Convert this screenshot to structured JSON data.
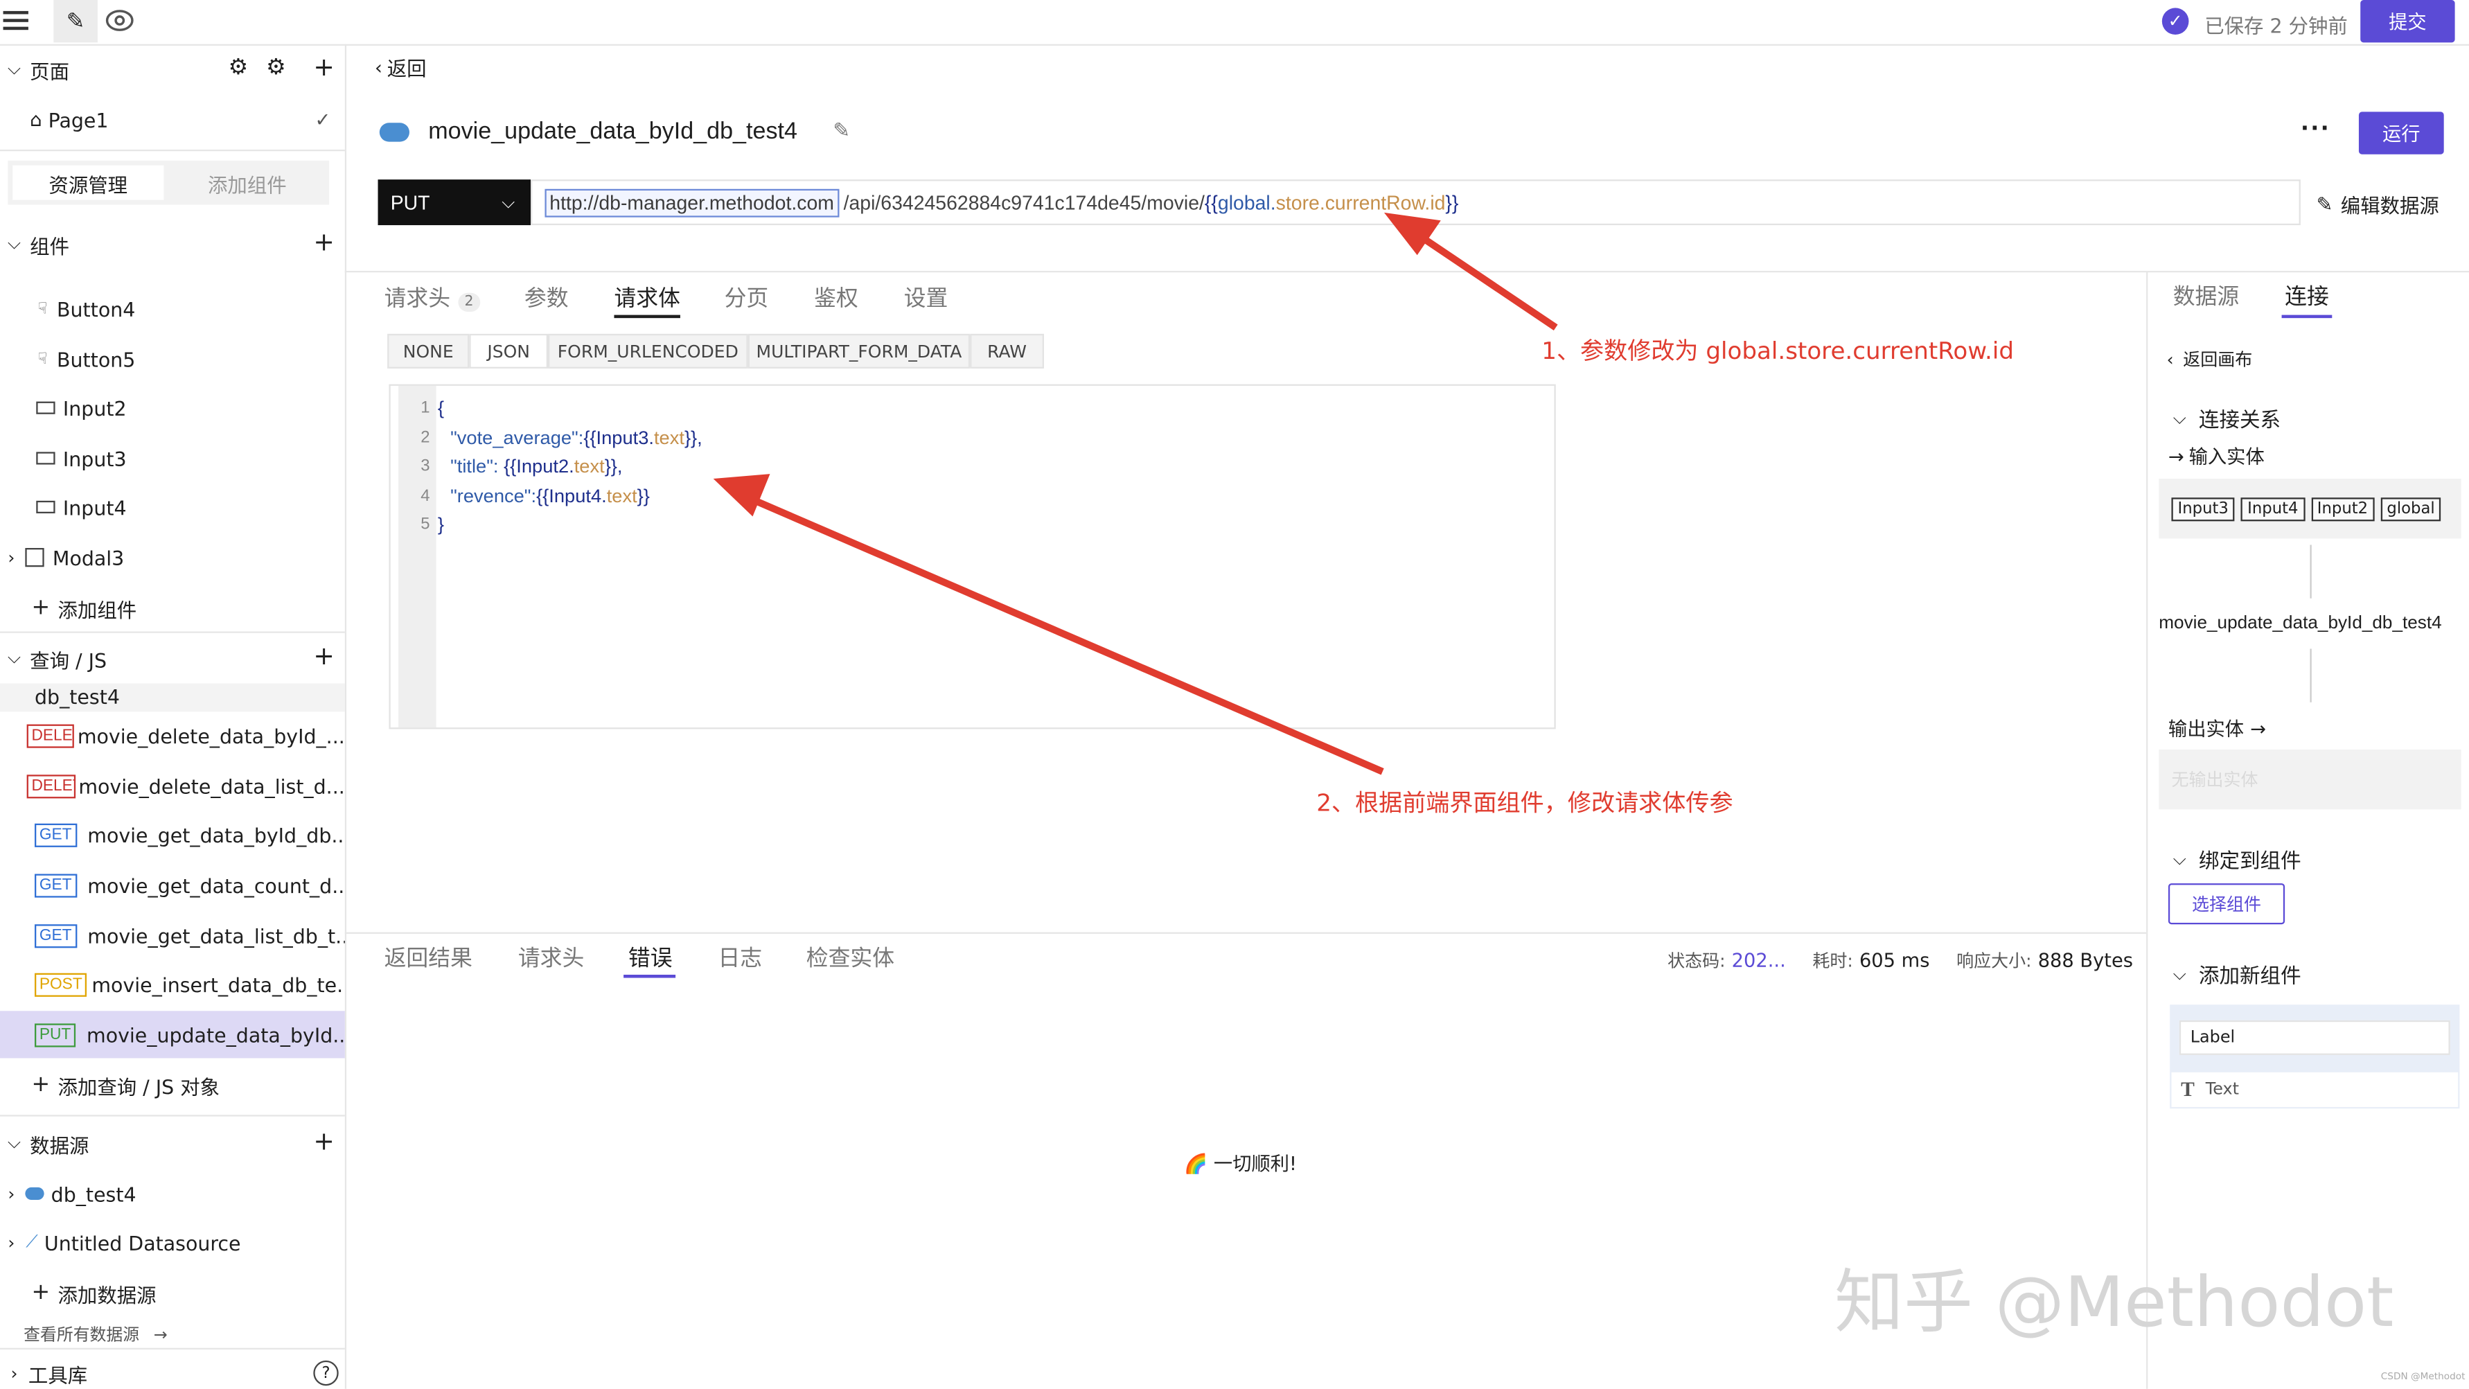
{
  "topbar": {
    "saved_text": "已保存 2 分钟前",
    "submit_label": "提交"
  },
  "sidebar": {
    "pages_title": "页面",
    "page1": "Page1",
    "tab_resources": "资源管理",
    "tab_add_component": "添加组件",
    "components_title": "组件",
    "components": [
      "Button4",
      "Button5",
      "Input2",
      "Input3",
      "Input4",
      "Modal3"
    ],
    "add_component": "添加组件",
    "queries_title": "查询 / JS",
    "queries_group": "db_test4",
    "queries": [
      {
        "method": "DELETE",
        "name": "movie_delete_data_byId_..."
      },
      {
        "method": "DELETE",
        "name": "movie_delete_data_list_d..."
      },
      {
        "method": "GET",
        "name": "movie_get_data_byId_db..."
      },
      {
        "method": "GET",
        "name": "movie_get_data_count_d..."
      },
      {
        "method": "GET",
        "name": "movie_get_data_list_db_t..."
      },
      {
        "method": "POST",
        "name": "movie_insert_data_db_te..."
      },
      {
        "method": "PUT",
        "name": "movie_update_data_byId..."
      }
    ],
    "add_query": "添加查询 / JS 对象",
    "datasources_title": "数据源",
    "datasources": [
      "db_test4",
      "Untitled Datasource"
    ],
    "add_datasource": "添加数据源",
    "view_all_datasources": "查看所有数据源",
    "library": "工具库"
  },
  "main": {
    "back_label": "返回",
    "query_name": "movie_update_data_byId_db_test4",
    "run_label": "运行",
    "method": "PUT",
    "url_base": "http://db-manager.methodot.com",
    "url_path": "/api/63424562884c9741c174de45/movie/",
    "url_binding_open": "{{",
    "url_binding_global": "global.",
    "url_binding_store": "store.currentRow.id",
    "url_binding_close": "}}",
    "edit_datasource": "编辑数据源",
    "tabs": [
      "请求头",
      "参数",
      "请求体",
      "分页",
      "鉴权",
      "设置"
    ],
    "header_count": "2",
    "body_tabs": [
      "NONE",
      "JSON",
      "FORM_URLENCODED",
      "MULTIPART_FORM_DATA",
      "RAW"
    ],
    "code_lines": [
      {
        "no": "1",
        "parts": [
          {
            "c": "p",
            "t": "{"
          }
        ]
      },
      {
        "no": "2",
        "parts": [
          {
            "c": "k",
            "t": "\"vote_average\":"
          },
          {
            "c": "p",
            "t": "{{Input3."
          },
          {
            "c": "t",
            "t": "text"
          },
          {
            "c": "p",
            "t": "}},"
          }
        ]
      },
      {
        "no": "3",
        "parts": [
          {
            "c": "k",
            "t": "\"title\": "
          },
          {
            "c": "p",
            "t": "{{Input2."
          },
          {
            "c": "t",
            "t": "text"
          },
          {
            "c": "p",
            "t": "}},"
          }
        ]
      },
      {
        "no": "4",
        "parts": [
          {
            "c": "k",
            "t": "\"revence\":"
          },
          {
            "c": "p",
            "t": "{{Input4."
          },
          {
            "c": "t",
            "t": "text"
          },
          {
            "c": "p",
            "t": "}}"
          }
        ]
      },
      {
        "no": "5",
        "parts": [
          {
            "c": "p",
            "t": "}"
          }
        ]
      }
    ],
    "annotation1": "1、参数修改为 global.store.currentRow.id",
    "annotation2": "2、根据前端界面组件，修改请求体传参",
    "result_tabs": [
      "返回结果",
      "请求头",
      "错误",
      "日志",
      "检查实体"
    ],
    "status_label": "状态码:",
    "status_value": "202...",
    "time_label": "耗时:",
    "time_value": "605 ms",
    "size_label": "响应大小:",
    "size_value": "888 Bytes",
    "success_msg": "🌈 一切顺利!"
  },
  "right_panel": {
    "tabs": [
      "数据源",
      "连接"
    ],
    "back_canvas": "返回画布",
    "relations_title": "连接关系",
    "input_entity": "输入实体",
    "input_chips": [
      "Input3",
      "Input4",
      "Input2",
      "global"
    ],
    "query_name": "movie_update_data_byId_db_test4",
    "output_entity": "输出实体",
    "no_output": "无输出实体",
    "bind_title": "绑定到组件",
    "select_component": "选择组件",
    "add_new_title": "添加新组件",
    "new_components": [
      "Label",
      "Text"
    ]
  },
  "watermark": "知乎 @Methodot",
  "watermark_small": "CSDN @Methodot",
  "colors": {
    "accent": "#5b4bd6",
    "annotation": "#e03c2f"
  }
}
